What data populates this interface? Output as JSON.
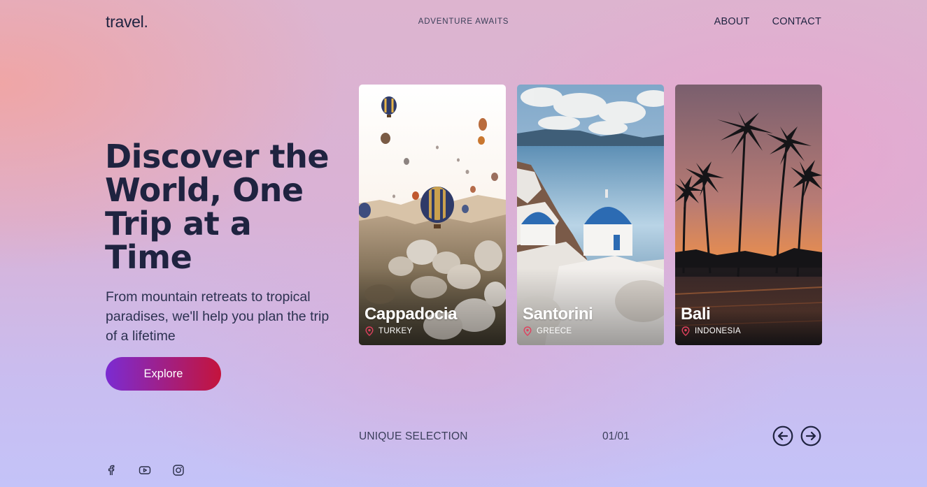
{
  "header": {
    "logo": "travel.",
    "tagline": "ADVENTURE AWAITS",
    "nav": [
      {
        "label": "ABOUT"
      },
      {
        "label": "CONTACT"
      }
    ]
  },
  "hero": {
    "title": "Discover the World, One Trip at a Time",
    "subtitle": "From mountain retreats to tropical paradises, we'll help you plan the trip of a lifetime",
    "cta_label": "Explore"
  },
  "cards": [
    {
      "name": "Cappadocia",
      "country": "TURKEY"
    },
    {
      "name": "Santorini",
      "country": "GREECE"
    },
    {
      "name": "Bali",
      "country": "INDONESIA"
    }
  ],
  "footer": {
    "section_label": "UNIQUE SELECTION",
    "counter": "01/01"
  },
  "icons": {
    "prev": "arrow-left-circle-icon",
    "next": "arrow-right-circle-icon",
    "pin": "map-pin-icon",
    "social": [
      "facebook-icon",
      "youtube-icon",
      "instagram-icon"
    ]
  },
  "colors": {
    "text_dark": "#1f2340",
    "button_start": "#7b2bd2",
    "button_end": "#c4143c",
    "pin": "#e0405e"
  }
}
